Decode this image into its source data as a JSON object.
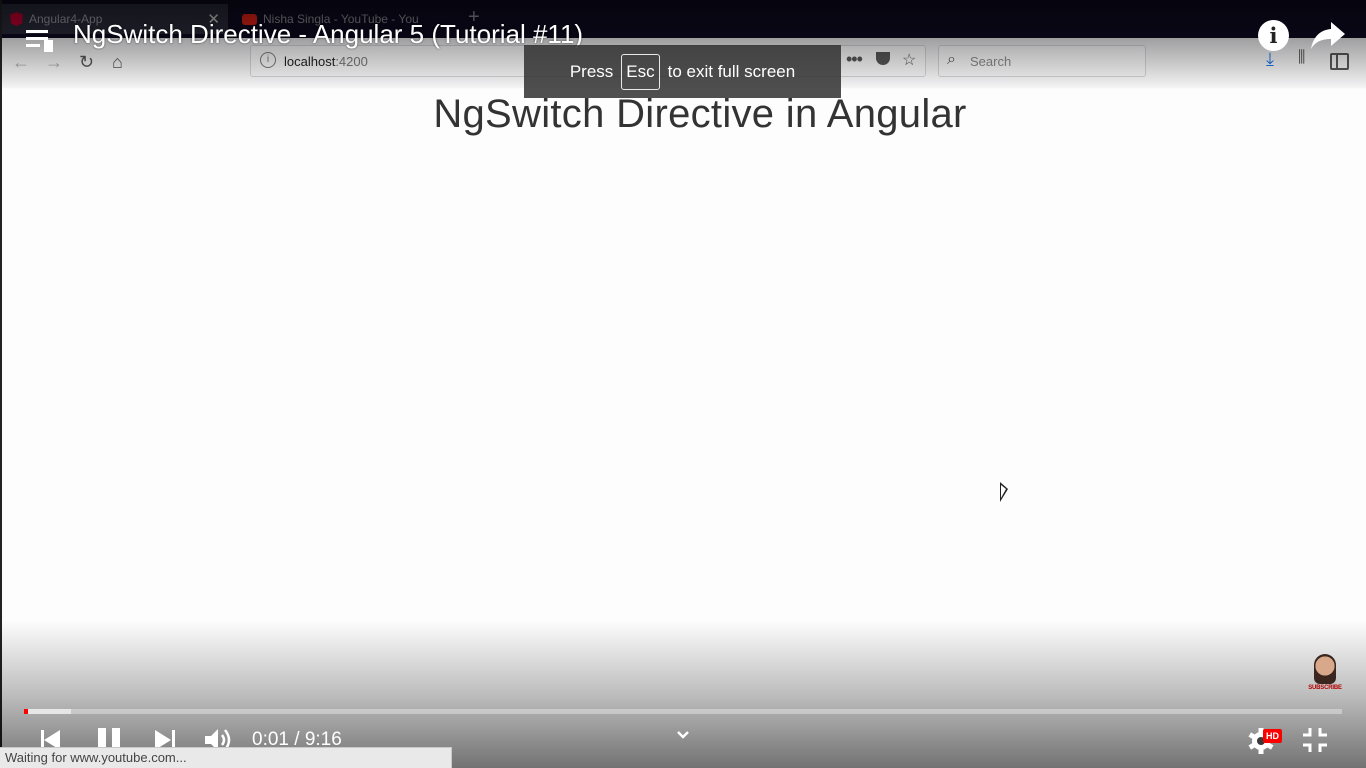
{
  "recorded_browser": {
    "tabs": [
      {
        "label": "Angular4-App",
        "close": "✕"
      },
      {
        "label": "Nisha Singla - YouTube - You"
      }
    ],
    "new_tab": "+",
    "url": {
      "host": "localhost",
      "port": ":4200"
    },
    "search_placeholder": "Search",
    "nav_icons": {
      "back": "←",
      "forward": "→",
      "reload": "↻",
      "home": "⌂",
      "more": "•••",
      "star": "☆",
      "download": "⤓",
      "library": "⫼"
    },
    "page_heading": "NgSwitch Directive in Angular"
  },
  "player": {
    "title": "NgSwitch Directive - Angular 5 (Tutorial #11)",
    "info_glyph": "i",
    "fullscreen_toast": {
      "prefix": "Press",
      "key": "Esc",
      "suffix": "to exit full screen"
    },
    "watermark_label": "SUBSCRIBE",
    "progress": {
      "played_fraction": 0.002,
      "buffered_fraction": 0.036
    },
    "time": {
      "current": "0:01",
      "separator": " / ",
      "duration": "9:16"
    },
    "hd_badge": "HD",
    "colors": {
      "progress_played": "#ff0000",
      "hd_badge": "#ff0000"
    }
  },
  "status_bar": {
    "text": "Waiting for www.youtube.com..."
  }
}
